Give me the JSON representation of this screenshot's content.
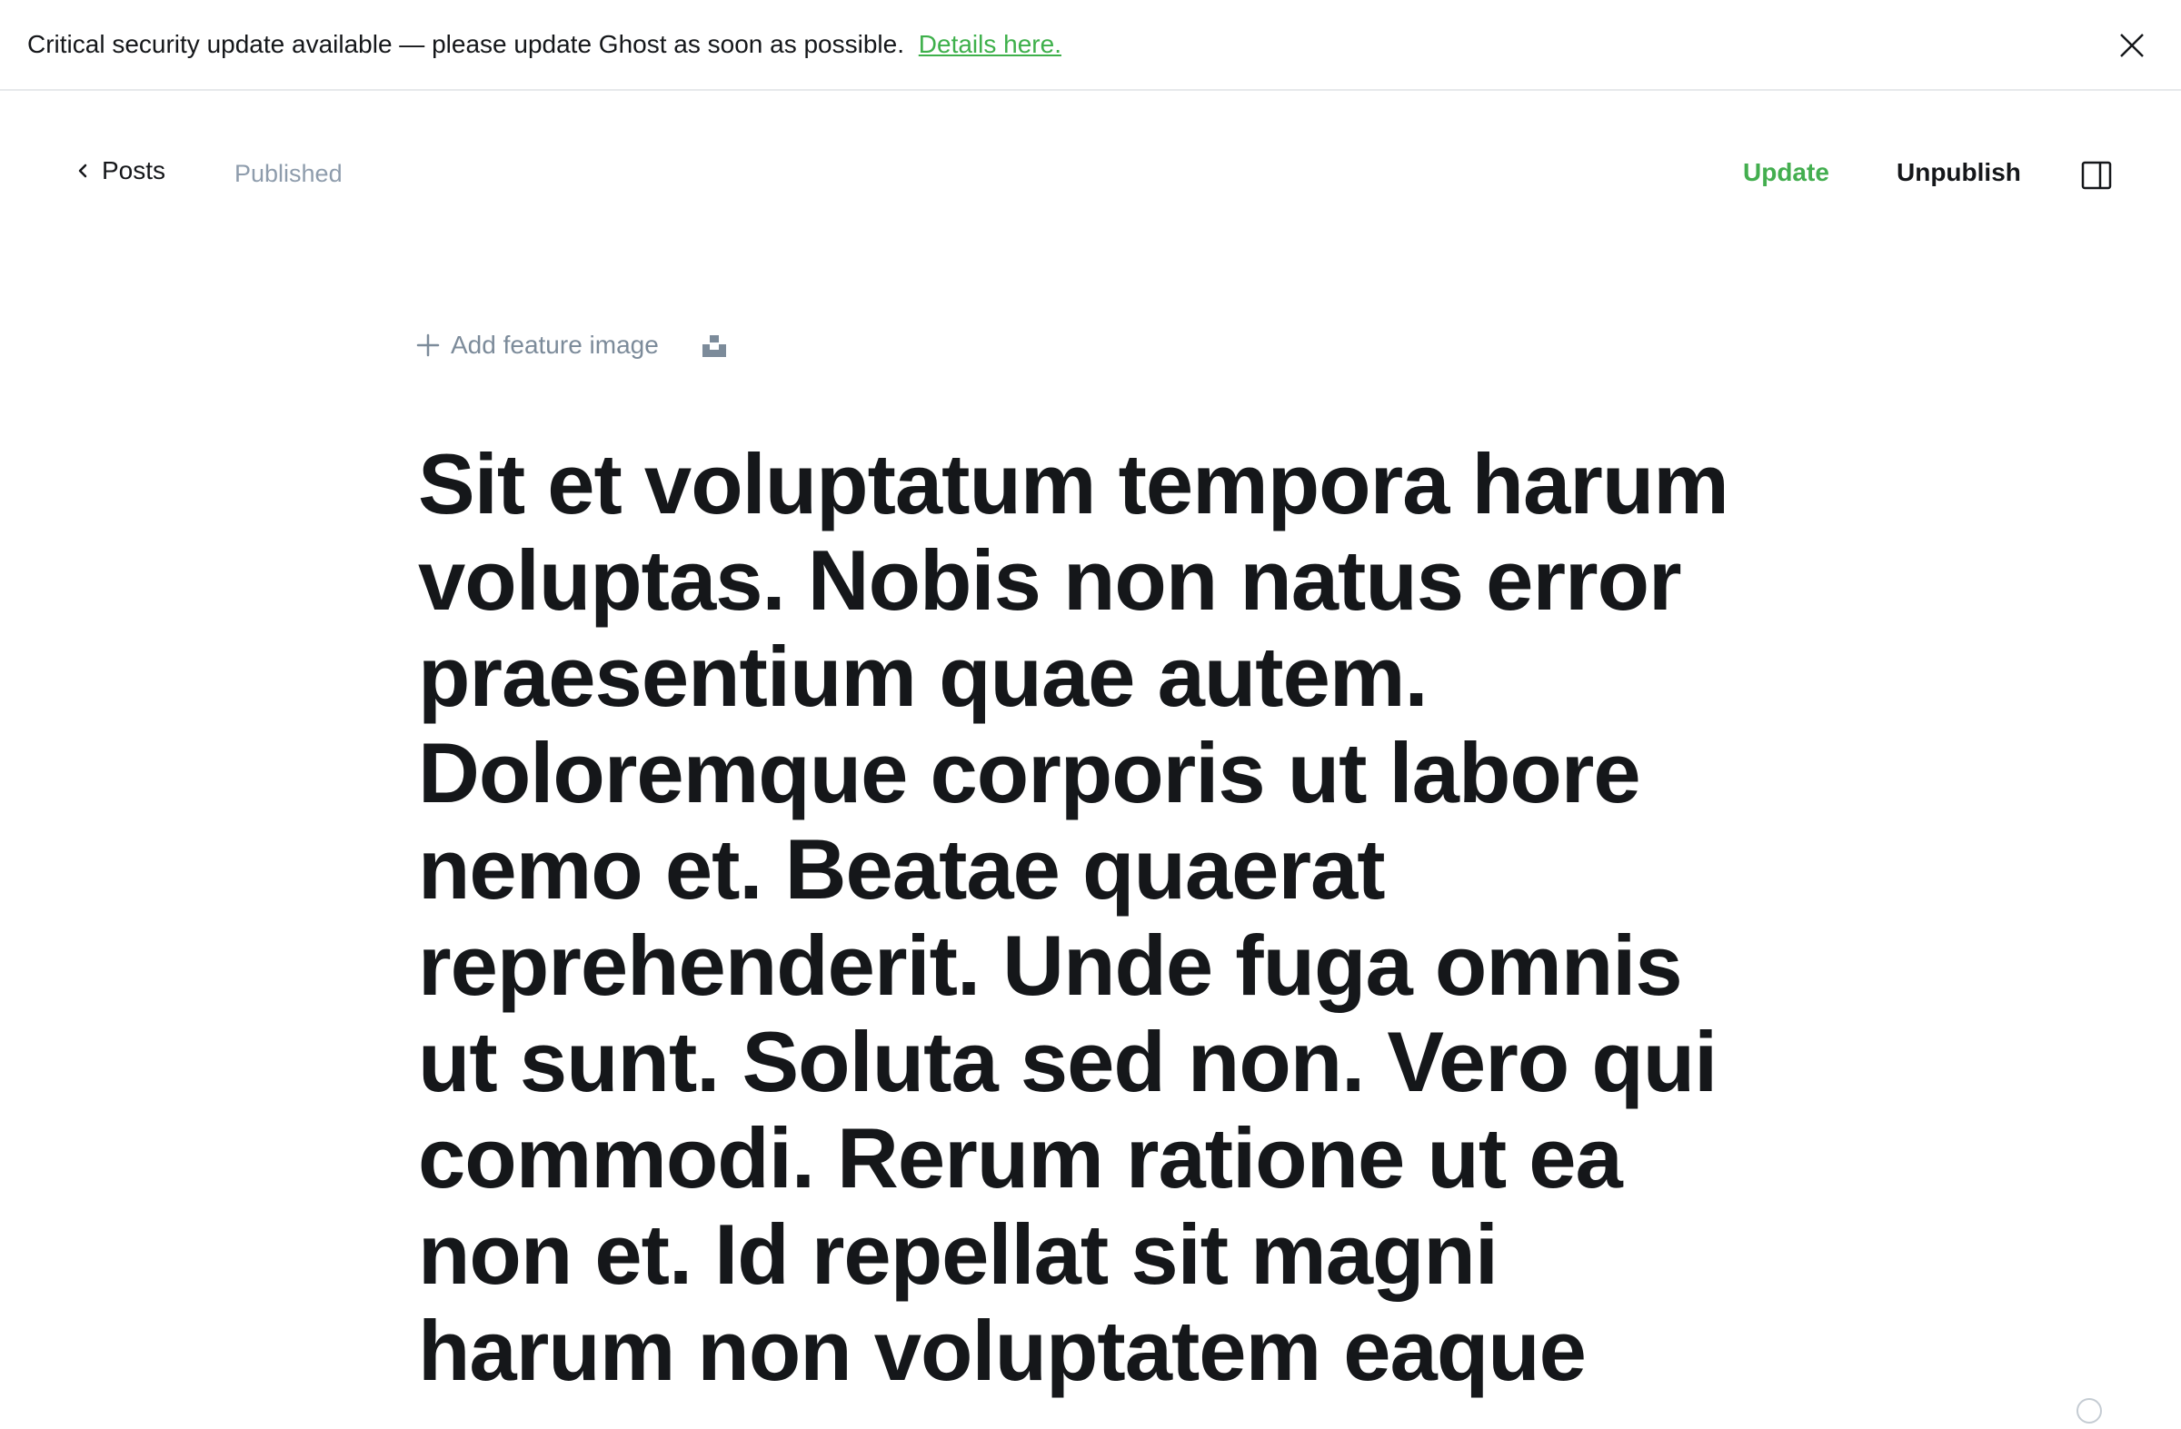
{
  "banner": {
    "message": "Critical security update available — please update Ghost as soon as possible.",
    "link_label": "Details here.",
    "close_icon": "close-icon"
  },
  "topbar": {
    "back_label": "Posts",
    "back_icon": "chevron-left-icon",
    "status": "Published",
    "update_label": "Update",
    "unpublish_label": "Unpublish",
    "sidebar_toggle_icon": "sidebar-panel-icon"
  },
  "editor": {
    "add_feature_image_label": "Add feature image",
    "add_icon": "plus-icon",
    "unsplash_icon": "unsplash-icon",
    "title": "Sit et voluptatum tempora harum voluptas. Nobis non natus error praesentium quae autem. Doloremque corporis ut labore nemo et. Beatae quaerat reprehenderit. Unde fuga omnis ut sunt. Soluta sed non. Vero qui commodi. Rerum ratione ut ea non et. Id repellat sit magni harum non voluptatem eaque"
  },
  "colors": {
    "accent_green": "#43ae4f",
    "text_primary": "#15171a",
    "text_muted": "#8e9cac"
  }
}
